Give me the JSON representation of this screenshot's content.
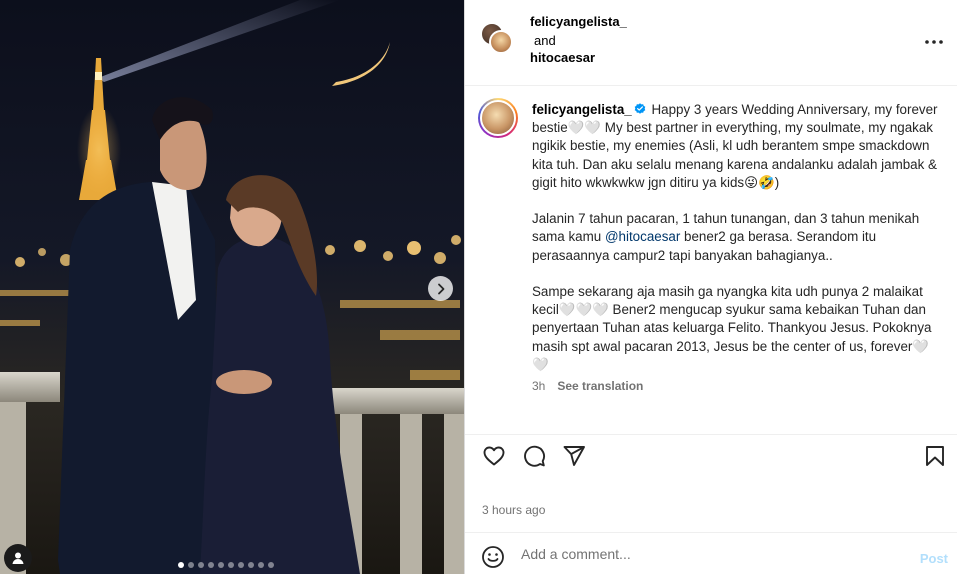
{
  "post": {
    "media": {
      "image_alt": "couple at Eiffel Tower at night",
      "carousel_dot_count": 10,
      "active_dot": 0,
      "next_icon": "chevron-right-icon",
      "tag_icon": "user-tag-icon"
    },
    "header": {
      "user1": "felicyangelista_",
      "and_text": "and",
      "user2": "hitocaesar",
      "more_icon": "more-horizontal-icon"
    },
    "caption": {
      "username": "felicyangelista_",
      "verified_icon": "verified-badge-icon",
      "verified_color": "#0095f6",
      "p1_text": " Happy 3 years Wedding Anniversary, my forever bestie🤍🤍 My best partner in everything, my soulmate, my ngakak ngikik bestie, my enemies (Asli, kl udh berantem smpe smackdown kita tuh. Dan aku selalu menang karena andalanku adalah jambak & gigit hito wkwkwkw jgn ditiru ya kids😜🤣)",
      "p2_before": "Jalanin 7 tahun pacaran, 1 tahun tunangan, dan 3 tahun menikah sama kamu ",
      "p2_mention": "@hitocaesar",
      "p2_after": " bener2 ga berasa. Serandom itu perasaannya campur2 tapi banyakan bahagianya..",
      "p3_text": "Sampe sekarang aja masih ga nyangka kita udh punya 2 malaikat kecil🤍🤍🤍 Bener2 mengucap syukur sama kebaikan Tuhan dan penyertaan Tuhan atas keluarga Felito. Thankyou Jesus. Pokoknya masih spt awal pacaran 2013, Jesus be the center of us, forever🤍🤍",
      "age": "3h",
      "see_translation": "See translation"
    },
    "actions": {
      "like_icon": "heart-icon",
      "comment_icon": "comment-icon",
      "share_icon": "send-icon",
      "save_icon": "bookmark-icon"
    },
    "timestamp": "3 hours ago",
    "comment_box": {
      "emoji_icon": "emoji-icon",
      "placeholder": "Add a comment...",
      "value": "",
      "post_label": "Post",
      "post_color": "#b2dffc"
    }
  }
}
